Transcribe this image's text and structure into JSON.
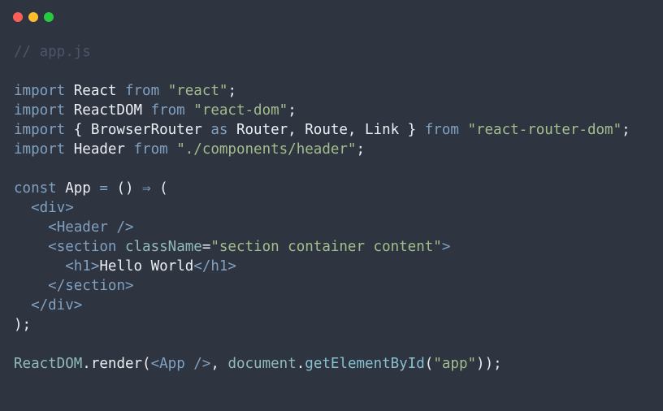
{
  "window": {
    "controls": [
      {
        "name": "close",
        "color": "#ff5f56"
      },
      {
        "name": "minimize",
        "color": "#ffbd2e"
      },
      {
        "name": "maximize",
        "color": "#27c93f"
      }
    ]
  },
  "code": {
    "lines": [
      [
        {
          "t": "// app.js",
          "k": "comment"
        }
      ],
      [],
      [
        {
          "t": "import",
          "k": "keyword"
        },
        {
          "t": " React ",
          "k": "ident"
        },
        {
          "t": "from",
          "k": "keyword"
        },
        {
          "t": " ",
          "k": "punct"
        },
        {
          "t": "\"react\"",
          "k": "string"
        },
        {
          "t": ";",
          "k": "punct"
        }
      ],
      [
        {
          "t": "import",
          "k": "keyword"
        },
        {
          "t": " ReactDOM ",
          "k": "ident"
        },
        {
          "t": "from",
          "k": "keyword"
        },
        {
          "t": " ",
          "k": "punct"
        },
        {
          "t": "\"react-dom\"",
          "k": "string"
        },
        {
          "t": ";",
          "k": "punct"
        }
      ],
      [
        {
          "t": "import",
          "k": "keyword"
        },
        {
          "t": " { BrowserRouter ",
          "k": "ident"
        },
        {
          "t": "as",
          "k": "keyword"
        },
        {
          "t": " Router, Route, Link } ",
          "k": "ident"
        },
        {
          "t": "from",
          "k": "keyword"
        },
        {
          "t": " ",
          "k": "punct"
        },
        {
          "t": "\"react-router-dom\"",
          "k": "string"
        },
        {
          "t": ";",
          "k": "punct"
        }
      ],
      [
        {
          "t": "import",
          "k": "keyword"
        },
        {
          "t": " Header ",
          "k": "ident"
        },
        {
          "t": "from",
          "k": "keyword"
        },
        {
          "t": " ",
          "k": "punct"
        },
        {
          "t": "\"./components/header\"",
          "k": "string"
        },
        {
          "t": ";",
          "k": "punct"
        }
      ],
      [],
      [
        {
          "t": "const",
          "k": "keyword"
        },
        {
          "t": " App ",
          "k": "ident"
        },
        {
          "t": "=",
          "k": "op"
        },
        {
          "t": " () ",
          "k": "punct"
        },
        {
          "t": "⇒",
          "k": "op"
        },
        {
          "t": " (",
          "k": "punct"
        }
      ],
      [
        {
          "t": "  ",
          "k": "punct"
        },
        {
          "t": "<div>",
          "k": "tag"
        }
      ],
      [
        {
          "t": "    ",
          "k": "punct"
        },
        {
          "t": "<Header />",
          "k": "tag"
        }
      ],
      [
        {
          "t": "    ",
          "k": "punct"
        },
        {
          "t": "<section",
          "k": "tag"
        },
        {
          "t": " className",
          "k": "attr"
        },
        {
          "t": "=",
          "k": "punct"
        },
        {
          "t": "\"section container content\"",
          "k": "string"
        },
        {
          "t": ">",
          "k": "tag"
        }
      ],
      [
        {
          "t": "      ",
          "k": "punct"
        },
        {
          "t": "<h1>",
          "k": "tag"
        },
        {
          "t": "Hello World",
          "k": "ident"
        },
        {
          "t": "</h1>",
          "k": "tag"
        }
      ],
      [
        {
          "t": "    ",
          "k": "punct"
        },
        {
          "t": "</section>",
          "k": "tag"
        }
      ],
      [
        {
          "t": "  ",
          "k": "punct"
        },
        {
          "t": "</div>",
          "k": "tag"
        }
      ],
      [
        {
          "t": ");",
          "k": "punct"
        }
      ],
      [],
      [
        {
          "t": "ReactDOM",
          "k": "attr"
        },
        {
          "t": ".render(",
          "k": "punct"
        },
        {
          "t": "<App />",
          "k": "tag"
        },
        {
          "t": ", ",
          "k": "punct"
        },
        {
          "t": "document",
          "k": "attr"
        },
        {
          "t": ".",
          "k": "punct"
        },
        {
          "t": "getElementById",
          "k": "func"
        },
        {
          "t": "(",
          "k": "punct"
        },
        {
          "t": "\"app\"",
          "k": "string"
        },
        {
          "t": "));",
          "k": "punct"
        }
      ]
    ]
  }
}
